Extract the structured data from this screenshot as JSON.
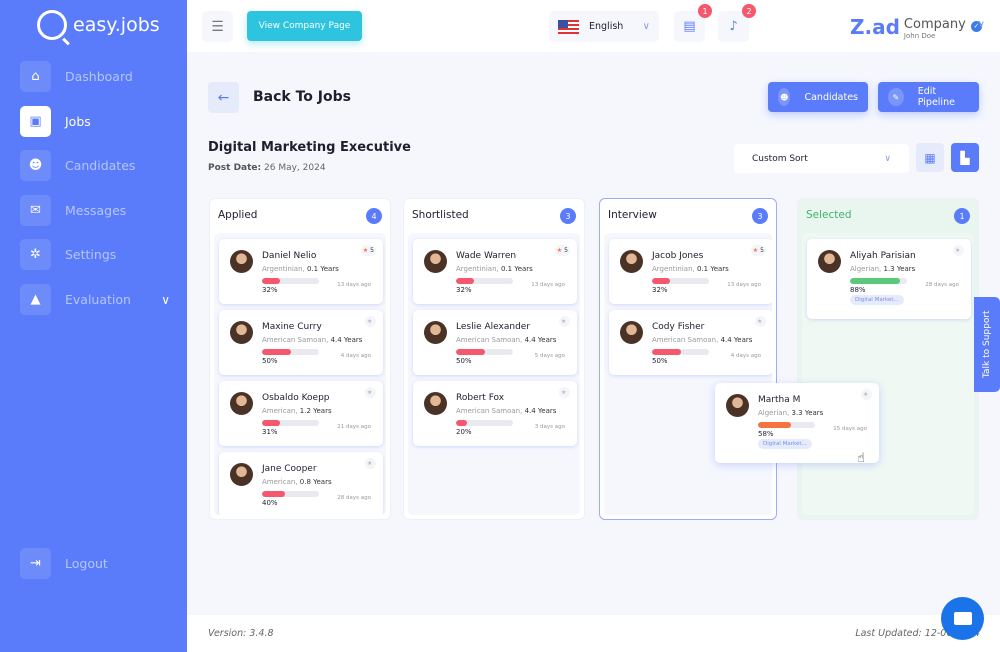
{
  "sidebar": {
    "brand": "easy.jobs",
    "items": [
      {
        "label": "Dashboard",
        "icon": "home-icon",
        "glyph": "⌂"
      },
      {
        "label": "Jobs",
        "icon": "briefcase-icon",
        "glyph": "▣",
        "active": true
      },
      {
        "label": "Candidates",
        "icon": "user-icon",
        "glyph": "☻"
      },
      {
        "label": "Messages",
        "icon": "chat-icon",
        "glyph": "✉"
      },
      {
        "label": "Settings",
        "icon": "gear-icon",
        "glyph": "✲"
      },
      {
        "label": "Evaluation",
        "icon": "graduation-cap-icon",
        "glyph": "▲",
        "chevron": true
      }
    ],
    "logout": "Logout"
  },
  "topbar": {
    "view_company": "View Company Page",
    "language": "English",
    "messages_badge": "1",
    "notifications_badge": "2",
    "company_logo": "Z.ad",
    "company_name": "Company",
    "user_name": "John Doe"
  },
  "header": {
    "back_label": "Back To Jobs",
    "candidates_btn": "Candidates",
    "edit_pipeline_btn": "Edit Pipeline",
    "job_title": "Digital Marketing Executive",
    "post_date_label": "Post Date:",
    "post_date": "26 May, 2024",
    "sort": "Custom Sort"
  },
  "colors": {
    "accent": "#5b7cfa",
    "teal": "#2ec3df",
    "red": "#f5576c",
    "green": "#5cc97a",
    "orange": "#f57340"
  },
  "pipeline": [
    {
      "name": "Applied",
      "count": "4",
      "cards": [
        {
          "name": "Daniel Nelio",
          "nationality": "Argentinian",
          "experience": "0.1 Years",
          "score": 32,
          "score_label": "32%",
          "ago": "13 days ago",
          "rating": "5"
        },
        {
          "name": "Maxine Curry",
          "nationality": "American Samoan",
          "experience": "4.4 Years",
          "score": 50,
          "score_label": "50%",
          "ago": "4 days ago"
        },
        {
          "name": "Osbaldo Koepp",
          "nationality": "American",
          "experience": "1.2 Years",
          "score": 31,
          "score_label": "31%",
          "ago": "21 days ago"
        },
        {
          "name": "Jane Cooper",
          "nationality": "American",
          "experience": "0.8 Years",
          "score": 40,
          "score_label": "40%",
          "ago": "28 days ago"
        }
      ]
    },
    {
      "name": "Shortlisted",
      "count": "3",
      "cards": [
        {
          "name": "Wade Warren",
          "nationality": "Argentinian",
          "experience": "0.1 Years",
          "score": 32,
          "score_label": "32%",
          "ago": "13 days ago",
          "rating": "5"
        },
        {
          "name": "Leslie Alexander",
          "nationality": "American Samoan",
          "experience": "4.4 Years",
          "score": 50,
          "score_label": "50%",
          "ago": "5 days ago"
        },
        {
          "name": "Robert Fox",
          "nationality": "American Samoan",
          "experience": "4.4 Years",
          "score": 20,
          "score_label": "20%",
          "ago": "3 days ago"
        }
      ]
    },
    {
      "name": "Interview",
      "count": "3",
      "cards": [
        {
          "name": "Jacob Jones",
          "nationality": "Argentinian",
          "experience": "0.1 Years",
          "score": 32,
          "score_label": "32%",
          "ago": "13 days ago",
          "rating": "5"
        },
        {
          "name": "Cody Fisher",
          "nationality": "American Samoan",
          "experience": "4.4 Years",
          "score": 50,
          "score_label": "50%",
          "ago": "4 days ago"
        }
      ]
    },
    {
      "name": "Selected",
      "count": "1",
      "cards": [
        {
          "name": "Aliyah Parisian",
          "nationality": "Algerian",
          "experience": "1.3 Years",
          "score": 88,
          "score_label": "88%",
          "ago": "28 days ago",
          "tag": "Digital Market...",
          "color": "green"
        }
      ]
    }
  ],
  "dragging_card": {
    "name": "Martha M",
    "nationality": "Algerian",
    "experience": "3.3 Years",
    "score": 58,
    "score_label": "58%",
    "ago": "15 days ago",
    "tag": "Digital Market...",
    "color": "orange"
  },
  "support_label": "Talk to Support",
  "footer": {
    "version": "Version: 3.4.8",
    "last_updated": "Last Updated: 12-06-2024"
  }
}
